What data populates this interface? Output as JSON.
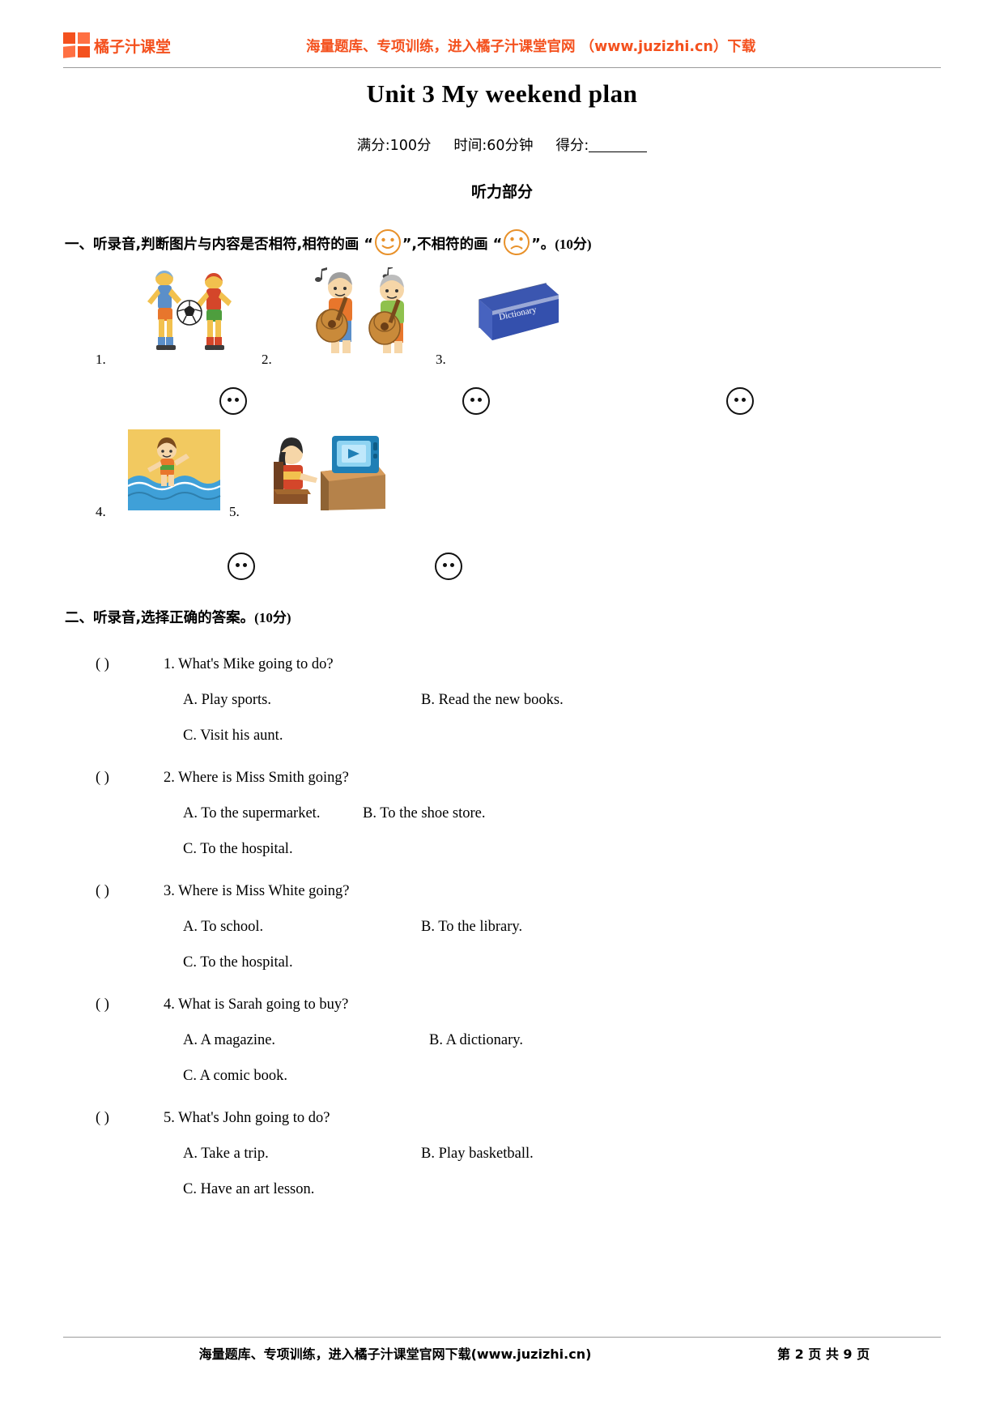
{
  "header": {
    "logo_text": "橘子汁课堂",
    "promo": "海量题库、专项训练，进入橘子汁课堂官网 （www.juzizhi.cn）下载",
    "brand_color": "#F4511E"
  },
  "title": "Unit 3    My weekend plan",
  "score_line": {
    "full_marks": "满分:100分",
    "time": "时间:60分钟",
    "score_label": "得分:"
  },
  "section_title": "听力部分",
  "question_one": {
    "number": "一、",
    "text_a": "听录音,判断图片与内容是否相符,相符的画",
    "quote_open": "“",
    "quote_close": "”",
    "text_b": ",不相符的画",
    "text_c": "。",
    "points": "(10分)",
    "items": [
      {
        "num": "1.",
        "alt": "two-boys-playing-soccer"
      },
      {
        "num": "2.",
        "alt": "two-people-playing-guitar"
      },
      {
        "num": "3.",
        "alt": "blue-dictionary-book"
      },
      {
        "num": "4.",
        "alt": "child-swimming-at-beach"
      },
      {
        "num": "5.",
        "alt": "person-watching-television"
      }
    ]
  },
  "question_two": {
    "number": "二、",
    "text": "听录音,选择正确的答案。",
    "points": "(10分)",
    "items": [
      {
        "paren": "(        )",
        "stem": "1. What's Mike going to do?",
        "a": "A. Play sports.",
        "b": "B. Read the new books.",
        "c": "C. Visit his aunt."
      },
      {
        "paren": "(        )",
        "stem": "2. Where is Miss Smith going?",
        "a": "A. To the supermarket.",
        "b": "B. To the shoe store.",
        "c": "C. To the hospital."
      },
      {
        "paren": "(        )",
        "stem": "3. Where is Miss White going?",
        "a": "A. To school.",
        "b": "B. To the library.",
        "c": "C. To the hospital."
      },
      {
        "paren": "(        )",
        "stem": "4. What is Sarah going to buy?",
        "a": "A. A magazine.",
        "b": "B. A dictionary.",
        "c": "C. A comic book."
      },
      {
        "paren": "(        )",
        "stem": "5. What's John going to do?",
        "a": "A. Take a trip.",
        "b": "B. Play basketball.",
        "c": "C. Have an art lesson."
      }
    ]
  },
  "footer": {
    "text": "海量题库、专项训练，进入橘子汁课堂官网下载(www.juzizhi.cn)",
    "page": "第 2 页 共 9 页"
  }
}
